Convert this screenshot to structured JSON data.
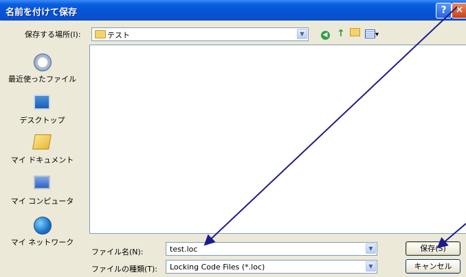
{
  "dialog": {
    "title": "名前を付けて保存",
    "help_glyph": "?",
    "close_glyph": "✕"
  },
  "location": {
    "label": "保存する場所(I):",
    "value": "テスト"
  },
  "toolbar": {
    "back_glyph": "◀",
    "up_glyph": "↑",
    "view_arrow": "▾"
  },
  "places": [
    {
      "label": "最近使ったファイル",
      "icon": "recent-files-icon"
    },
    {
      "label": "デスクトップ",
      "icon": "desktop-icon"
    },
    {
      "label": "マイ ドキュメント",
      "icon": "my-documents-icon"
    },
    {
      "label": "マイ コンピュータ",
      "icon": "my-computer-icon"
    },
    {
      "label": "マイ ネットワーク",
      "icon": "my-network-icon"
    }
  ],
  "form": {
    "filename_label": "ファイル名(N):",
    "filename_value": "test.loc",
    "filetype_label": "ファイルの種類(T):",
    "filetype_value": "Locking Code Files (*.loc)"
  },
  "buttons": {
    "save": "保存(S)",
    "cancel": "キャンセル"
  },
  "colors": {
    "title_bar": "#0553d6",
    "dialog_bg": "#ece9d8",
    "annotation_arrow": "#1b1b8f"
  }
}
